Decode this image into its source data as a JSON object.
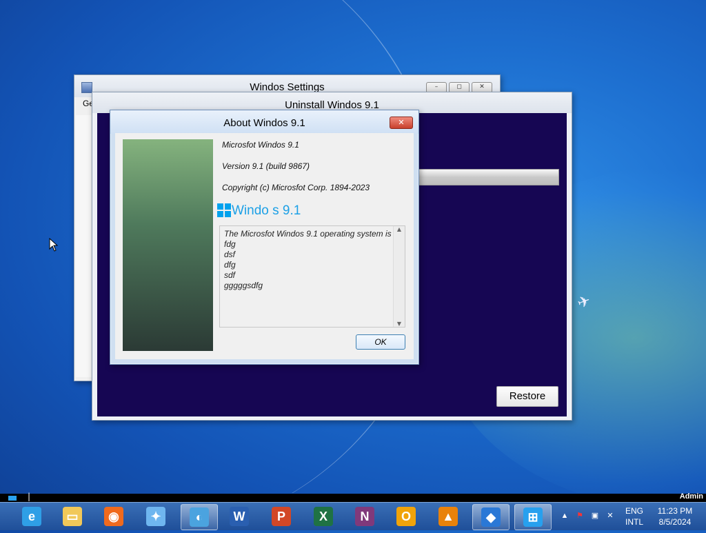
{
  "settings_window": {
    "title": "Windos Settings",
    "fragment": "Ge",
    "min": "–",
    "max": "◻",
    "close": "✕"
  },
  "uninstall_window": {
    "title": "Uninstall Windos 9.1",
    "restore_label": "Restore"
  },
  "about_window": {
    "title": "About Windos 9.1",
    "close": "✕",
    "product": "Microsfot Windos 9.1",
    "version": "Version 9.1 (build 9867)",
    "copyright": "Copyright (c) Microsfot Corp. 1894-2023",
    "logo_text": "Windo  s 9.1",
    "description_lines": [
      "The Microsfot Windos 9.1 operating system is",
      "fdg",
      "dsf",
      "dfg",
      "sdf",
      "gggggsdfg"
    ],
    "ok_label": "OK"
  },
  "top_strip": {
    "user": "Admin",
    "cursor_char": "|"
  },
  "taskbar": {
    "pinned": [
      {
        "name": "internet-explorer-icon",
        "glyph": "e",
        "color": "#2f9fe6"
      },
      {
        "name": "file-explorer-icon",
        "glyph": "▭",
        "color": "#f1c859"
      },
      {
        "name": "firefox-icon",
        "glyph": "◉",
        "color": "#f06a1d"
      },
      {
        "name": "network-people-icon",
        "glyph": "✦",
        "color": "#6fb6ef"
      },
      {
        "name": "browser-globe-icon",
        "glyph": "◐",
        "color": "#4ba3df"
      },
      {
        "name": "word-icon",
        "glyph": "W",
        "color": "#2a5fb0"
      },
      {
        "name": "powerpoint-icon",
        "glyph": "P",
        "color": "#d24726"
      },
      {
        "name": "excel-icon",
        "glyph": "X",
        "color": "#1f7244"
      },
      {
        "name": "onenote-icon",
        "glyph": "N",
        "color": "#80397b"
      },
      {
        "name": "outlook-icon",
        "glyph": "O",
        "color": "#f0a30a"
      },
      {
        "name": "vlc-icon",
        "glyph": "▲",
        "color": "#e9820b"
      },
      {
        "name": "app-wing-icon",
        "glyph": "◆",
        "color": "#2a78d6"
      },
      {
        "name": "windows-app-icon",
        "glyph": "⊞",
        "color": "#27a0ee"
      }
    ],
    "language": "ENG",
    "layout": "INTL",
    "time": "11:23 PM",
    "date": "8/5/2024"
  }
}
